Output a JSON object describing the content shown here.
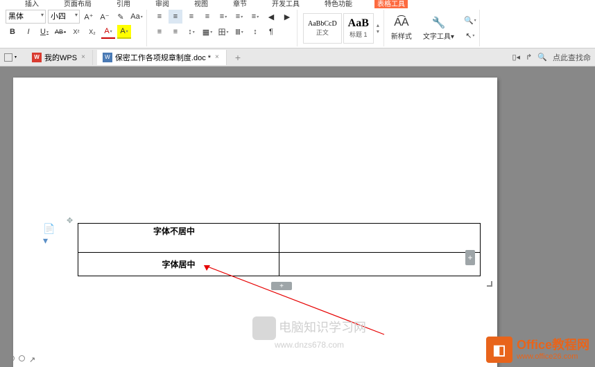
{
  "tabs": [
    "插入",
    "页面布局",
    "引用",
    "审阅",
    "视图",
    "章节",
    "开发工具",
    "特色功能",
    "表格工具"
  ],
  "font": {
    "name": "黑体",
    "size": "小四"
  },
  "fbtns": {
    "aplus": "A⁺",
    "aminus": "A⁻",
    "clear": "✎",
    "b": "B",
    "i": "I",
    "u": "U",
    "strike": "AB",
    "sup": "X²",
    "sub": "X₂",
    "fcolor": "A",
    "hilite": "A",
    "case": "Aa"
  },
  "para": {
    "al1": "≡",
    "al2": "≡",
    "al3": "≡",
    "al4": "≡",
    "list1": "≡",
    "list2": "≡",
    "list3": "≡",
    "indent1": "◀",
    "indent2": "▶",
    "spacing": "↕",
    "shade": "▦",
    "border": "田"
  },
  "styles": {
    "normal": {
      "preview": "AaBbCcD",
      "label": "正文"
    },
    "h1": {
      "preview": "AaB",
      "label": "标题 1"
    }
  },
  "btns": {
    "newstyle": "新样式",
    "texttool": "文字工具",
    "find": "查找替换",
    "select": "选择"
  },
  "doctabs": {
    "wps": "我的WPS",
    "doc": "保密工作各项规章制度.doc *"
  },
  "search_hint": "点此查找命",
  "table": {
    "cell_top": "字体不居中",
    "cell_bottom": "字体居中"
  },
  "watermark": {
    "text": "电脑知识学习网",
    "url": "www.dnzs678.com"
  },
  "brand": {
    "title": "Office教程网",
    "url": "www.office26.com"
  }
}
